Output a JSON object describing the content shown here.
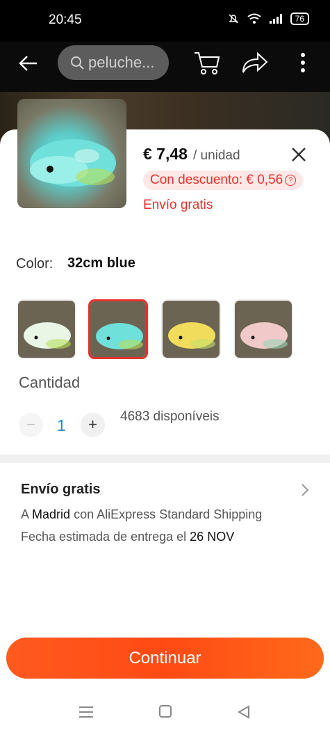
{
  "status_bar": {
    "time": "20:45",
    "battery": "76"
  },
  "header": {
    "search_placeholder": "peluche..."
  },
  "product": {
    "price": "€ 7,48",
    "unit": "/ unidad",
    "discount": "Con descuento: € 0,56",
    "free_shipping": "Envío gratis"
  },
  "color": {
    "label": "Color:",
    "selected_value": "32cm blue",
    "variants": [
      "white",
      "blue",
      "yellow",
      "pink"
    ]
  },
  "quantity": {
    "label": "Cantidad",
    "value": "1",
    "stock": "4683 disponíveis"
  },
  "shipping": {
    "title": "Envío gratis",
    "line1_prefix": "A",
    "destination": "Madrid",
    "line1_suffix": "con AliExpress Standard Shipping",
    "line2_prefix": "Fecha estimada de entrega el",
    "delivery_date": "26 NOV"
  },
  "actions": {
    "continue_label": "Continuar"
  },
  "colors": {
    "accent": "#e5322d",
    "button": "#ff4a14",
    "quantity": "#1a8ed1"
  }
}
